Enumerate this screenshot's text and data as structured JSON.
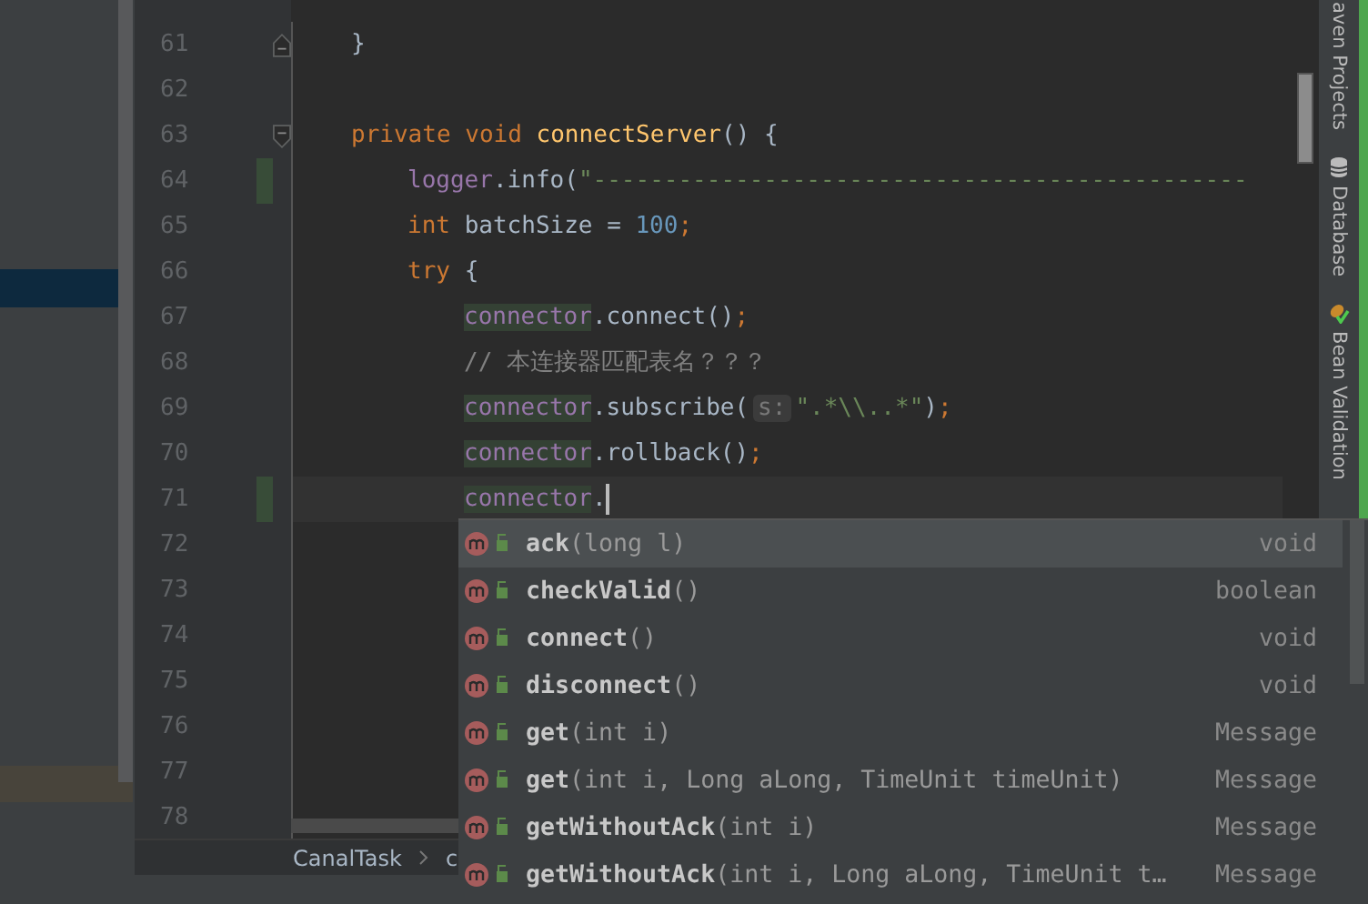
{
  "editor": {
    "lines": [
      {
        "number": "61",
        "kind": "member",
        "fold_start": false,
        "fold_end": true,
        "changed": false,
        "current": false,
        "tokens": [
          {
            "kind": "plain",
            "text": "}"
          }
        ]
      },
      {
        "number": "62",
        "kind": "blank",
        "fold_start": false,
        "fold_end": false,
        "changed": false,
        "current": false
      },
      {
        "number": "63",
        "kind": "member",
        "fold_start": true,
        "fold_end": false,
        "changed": false,
        "current": false,
        "tokens": [
          {
            "kind": "keyword",
            "text": "private "
          },
          {
            "kind": "keyword",
            "text": "void "
          },
          {
            "kind": "method",
            "text": "connectServer"
          },
          {
            "kind": "plain",
            "text": "() {"
          }
        ]
      },
      {
        "number": "64",
        "kind": "statement",
        "fold_start": false,
        "fold_end": false,
        "changed": true,
        "current": false,
        "tokens": [
          {
            "kind": "field",
            "text": "logger"
          },
          {
            "kind": "plain",
            "text": ".info("
          },
          {
            "kind": "string",
            "text": "\"----------------------------------------------"
          }
        ]
      },
      {
        "number": "65",
        "kind": "statement",
        "fold_start": false,
        "fold_end": false,
        "changed": false,
        "current": false,
        "tokens": [
          {
            "kind": "keyword",
            "text": "int "
          },
          {
            "kind": "plain",
            "text": "batchSize = "
          },
          {
            "kind": "number",
            "text": "100"
          },
          {
            "kind": "punct",
            "text": ";"
          }
        ]
      },
      {
        "number": "66",
        "kind": "statement",
        "fold_start": false,
        "fold_end": false,
        "changed": false,
        "current": false,
        "tokens": [
          {
            "kind": "keyword",
            "text": "try "
          },
          {
            "kind": "plain",
            "text": "{"
          }
        ]
      },
      {
        "number": "67",
        "kind": "nested",
        "fold_start": false,
        "fold_end": false,
        "changed": false,
        "current": false,
        "tokens": [
          {
            "kind": "usage",
            "text": "connector"
          },
          {
            "kind": "plain",
            "text": ".connect()"
          },
          {
            "kind": "punct",
            "text": ";"
          }
        ]
      },
      {
        "number": "68",
        "kind": "nested",
        "fold_start": false,
        "fold_end": false,
        "changed": false,
        "current": false,
        "tokens": [
          {
            "kind": "comment",
            "text": "// 本连接器匹配表名？？？"
          }
        ]
      },
      {
        "number": "69",
        "kind": "nested",
        "fold_start": false,
        "fold_end": false,
        "changed": false,
        "current": false,
        "tokens": [
          {
            "kind": "usage",
            "text": "connector"
          },
          {
            "kind": "plain",
            "text": ".subscribe("
          },
          {
            "kind": "hint",
            "text": "s:"
          },
          {
            "kind": "string",
            "text": "\".*\\\\..*\""
          },
          {
            "kind": "plain",
            "text": ")"
          },
          {
            "kind": "punct",
            "text": ";"
          }
        ]
      },
      {
        "number": "70",
        "kind": "nested",
        "fold_start": false,
        "fold_end": false,
        "changed": false,
        "current": false,
        "tokens": [
          {
            "kind": "usage",
            "text": "connector"
          },
          {
            "kind": "plain",
            "text": ".rollback()"
          },
          {
            "kind": "punct",
            "text": ";"
          }
        ]
      },
      {
        "number": "71",
        "kind": "nested",
        "fold_start": false,
        "fold_end": false,
        "changed": true,
        "current": true,
        "tokens": [
          {
            "kind": "usage",
            "text": "connector"
          },
          {
            "kind": "plain",
            "text": "."
          }
        ]
      },
      {
        "number": "72",
        "kind": "blank",
        "fold_start": false,
        "fold_end": false,
        "changed": false,
        "current": false
      },
      {
        "number": "73",
        "kind": "blank",
        "fold_start": false,
        "fold_end": false,
        "changed": false,
        "current": false
      },
      {
        "number": "74",
        "kind": "blank",
        "fold_start": false,
        "fold_end": false,
        "changed": false,
        "current": false
      },
      {
        "number": "75",
        "kind": "blank",
        "fold_start": false,
        "fold_end": false,
        "changed": false,
        "current": false
      },
      {
        "number": "76",
        "kind": "blank",
        "fold_start": false,
        "fold_end": false,
        "changed": false,
        "current": false
      },
      {
        "number": "77",
        "kind": "blank",
        "fold_start": false,
        "fold_end": false,
        "changed": false,
        "current": false
      },
      {
        "number": "78",
        "kind": "blank",
        "fold_start": false,
        "fold_end": false,
        "changed": false,
        "current": false
      }
    ]
  },
  "completion": {
    "items": [
      {
        "name": "ack",
        "params": "(long l)",
        "type": "void",
        "selected": true
      },
      {
        "name": "checkValid",
        "params": "()",
        "type": "boolean",
        "selected": false
      },
      {
        "name": "connect",
        "params": "()",
        "type": "void",
        "selected": false
      },
      {
        "name": "disconnect",
        "params": "()",
        "type": "void",
        "selected": false
      },
      {
        "name": "get",
        "params": "(int i)",
        "type": "Message",
        "selected": false
      },
      {
        "name": "get",
        "params": "(int i, Long aLong, TimeUnit timeUnit)",
        "type": "Message",
        "selected": false
      },
      {
        "name": "getWithoutAck",
        "params": "(int i)",
        "type": "Message",
        "selected": false
      },
      {
        "name": "getWithoutAck",
        "params": "(int i, Long aLong, TimeUnit t…",
        "type": "Message",
        "selected": false
      }
    ]
  },
  "breadcrumbs": [
    "CanalTask",
    "c"
  ],
  "tool_windows": [
    "aven Projects",
    "Database",
    "Bean Validation"
  ]
}
